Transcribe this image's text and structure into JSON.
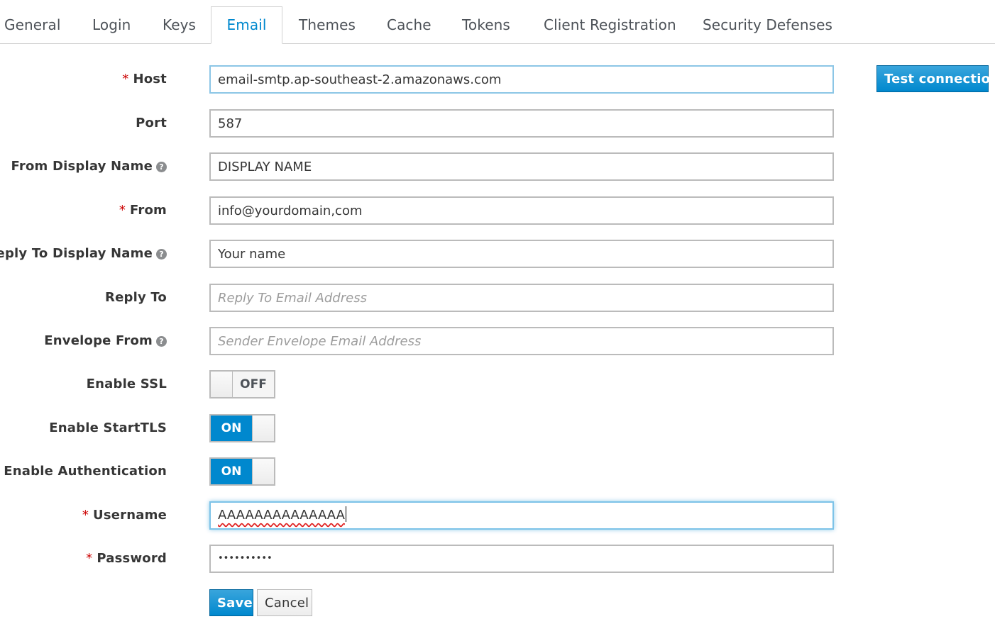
{
  "tabs": [
    {
      "label": "General",
      "active": false
    },
    {
      "label": "Login",
      "active": false
    },
    {
      "label": "Keys",
      "active": false
    },
    {
      "label": "Email",
      "active": true
    },
    {
      "label": "Themes",
      "active": false
    },
    {
      "label": "Cache",
      "active": false
    },
    {
      "label": "Tokens",
      "active": false
    },
    {
      "label": "Client Registration",
      "active": false
    },
    {
      "label": "Security Defenses",
      "active": false
    }
  ],
  "form": {
    "required_marker": "*",
    "help_icon": "?",
    "host": {
      "label": "Host",
      "value": "email-smtp.ap-southeast-2.amazonaws.com",
      "required": true
    },
    "port": {
      "label": "Port",
      "value": "587"
    },
    "from_display_name": {
      "label": "From Display Name",
      "value": "DISPLAY NAME"
    },
    "from": {
      "label": "From",
      "value": "info@yourdomain,com",
      "required": true
    },
    "reply_to_display_name": {
      "label": "Reply To Display Name",
      "value": "Your name"
    },
    "reply_to": {
      "label": "Reply To",
      "value": "",
      "placeholder": "Reply To Email Address"
    },
    "envelope_from": {
      "label": "Envelope From",
      "value": "",
      "placeholder": "Sender Envelope Email Address"
    },
    "enable_ssl": {
      "label": "Enable SSL",
      "state": "OFF"
    },
    "enable_starttls": {
      "label": "Enable StartTLS",
      "state": "ON"
    },
    "enable_authentication": {
      "label": "Enable Authentication",
      "state": "ON"
    },
    "username": {
      "label": "Username",
      "value": "AAAAAAAAAAAAAA",
      "required": true
    },
    "password": {
      "label": "Password",
      "value": "••••••••••",
      "required": true
    }
  },
  "buttons": {
    "test_connection": "Test connection",
    "save": "Save",
    "cancel": "Cancel"
  },
  "colors": {
    "accent": "#0088ce",
    "required": "#cc0000"
  }
}
